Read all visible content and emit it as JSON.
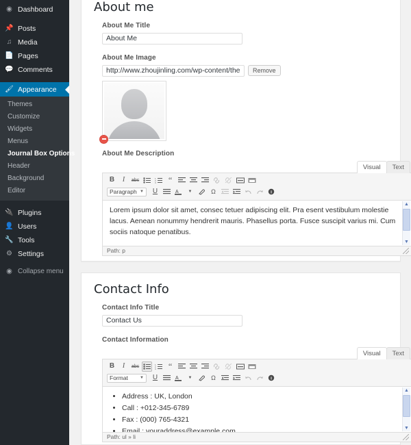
{
  "sidebar": {
    "top_items": [
      {
        "label": "Dashboard",
        "icon": "dashboard-icon"
      },
      {
        "label": "Posts",
        "icon": "pin-icon"
      },
      {
        "label": "Media",
        "icon": "media-icon"
      },
      {
        "label": "Pages",
        "icon": "page-icon"
      },
      {
        "label": "Comments",
        "icon": "comment-icon"
      }
    ],
    "appearance": {
      "label": "Appearance",
      "icon": "brush-icon"
    },
    "appearance_submenu": [
      {
        "label": "Themes",
        "current": false
      },
      {
        "label": "Customize",
        "current": false
      },
      {
        "label": "Widgets",
        "current": false
      },
      {
        "label": "Menus",
        "current": false
      },
      {
        "label": "Journal Box Options",
        "current": true
      },
      {
        "label": "Header",
        "current": false
      },
      {
        "label": "Background",
        "current": false
      },
      {
        "label": "Editor",
        "current": false
      }
    ],
    "bottom_items": [
      {
        "label": "Plugins",
        "icon": "plug-icon"
      },
      {
        "label": "Users",
        "icon": "user-icon"
      },
      {
        "label": "Tools",
        "icon": "wrench-icon"
      },
      {
        "label": "Settings",
        "icon": "settings-icon"
      }
    ],
    "collapse": {
      "label": "Collapse menu",
      "icon": "collapse-icon"
    },
    "highlight_color": "#0073aa",
    "background_color": "#23282d",
    "submenu_background_color": "#32373c"
  },
  "about_panel": {
    "title": "About me",
    "title_field": {
      "label": "About Me Title",
      "value": "About Me"
    },
    "image_field": {
      "label": "About Me Image",
      "value": "http://www.zhoujinling.com/wp-content/themes/jc",
      "remove_button": "Remove",
      "badge_icon": "remove-badge-icon",
      "thumbnail_icon": "avatar-placeholder-icon"
    },
    "description_field": {
      "label": "About Me Description",
      "tabs": {
        "visual": "Visual",
        "text": "Text",
        "active": "Visual"
      },
      "format_select": "Paragraph",
      "content": "Lorem ipsum dolor sit amet, consec tetuer adipiscing elit. Pra esent vestibulum molestie lacus. Aenean nonummy hendrerit mauris. Phasellus porta. Fusce suscipit varius mi. Cum sociis natoque penatibus.",
      "status": "Path: p"
    }
  },
  "contact_panel": {
    "title": "Contact Info",
    "title_field": {
      "label": "Contact Info Title",
      "value": "Contact Us"
    },
    "information_field": {
      "label": "Contact Information",
      "tabs": {
        "visual": "Visual",
        "text": "Text",
        "active": "Visual"
      },
      "format_select": "Format",
      "items": [
        "Address : UK, London",
        "Call : +012-345-6789",
        "Fax : (000) 765-4321",
        "Email : vouraddress@example.com"
      ],
      "status": "Path: ul » li"
    }
  },
  "editor_toolbar": {
    "row1": [
      {
        "name": "bold-icon",
        "glyph": "B",
        "style": "bold"
      },
      {
        "name": "italic-icon",
        "glyph": "I",
        "style": "italic"
      },
      {
        "name": "strikethrough-icon",
        "glyph": "abc",
        "style": "strike"
      },
      {
        "name": "unordered-list-icon",
        "glyph": "list"
      },
      {
        "name": "ordered-list-icon",
        "glyph": "numlist"
      },
      {
        "name": "blockquote-icon",
        "glyph": "“"
      },
      {
        "name": "align-left-icon",
        "glyph": "alignleft"
      },
      {
        "name": "align-center-icon",
        "glyph": "aligncenter"
      },
      {
        "name": "align-right-icon",
        "glyph": "alignright"
      },
      {
        "name": "link-icon",
        "glyph": "link",
        "dim": true
      },
      {
        "name": "unlink-icon",
        "glyph": "unlink",
        "dim": true
      },
      {
        "name": "more-tag-icon",
        "glyph": "more"
      },
      {
        "name": "fullscreen-icon",
        "glyph": "fullscreen"
      }
    ],
    "row2": [
      {
        "name": "underline-icon",
        "glyph": "U",
        "style": "underline"
      },
      {
        "name": "justify-icon",
        "glyph": "justify"
      },
      {
        "name": "text-color-icon",
        "glyph": "A",
        "style": "colorA"
      },
      {
        "name": "text-color-dropdown-icon",
        "glyph": "▾"
      },
      {
        "name": "paste-as-text-icon",
        "glyph": "eraser"
      },
      {
        "name": "special-character-icon",
        "glyph": "Ω"
      },
      {
        "name": "outdent-icon",
        "glyph": "outdent",
        "dim": true
      },
      {
        "name": "indent-icon",
        "glyph": "indent"
      },
      {
        "name": "undo-icon",
        "glyph": "undo",
        "dim": true
      },
      {
        "name": "redo-icon",
        "glyph": "redo",
        "dim": true
      },
      {
        "name": "help-icon",
        "glyph": "?"
      }
    ]
  }
}
